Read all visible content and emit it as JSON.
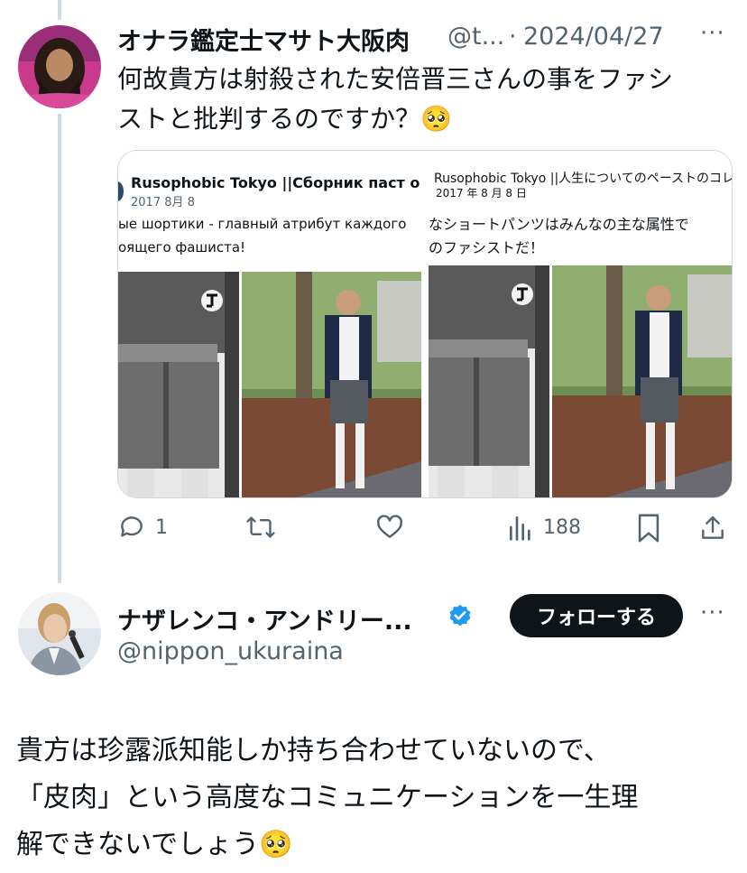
{
  "tweet1": {
    "display_name": "オナラ鑑定士マサト大阪肉",
    "handle": "@t...",
    "separator": "·",
    "date": "2024/04/27",
    "text_line1": "何故貴方は射殺された安倍晋三さんの事をファシ",
    "text_line2": "ストと批判するのですか？",
    "text_emoji": "🥺",
    "image_card": {
      "left": {
        "title": "Rusophobic Tokyo ||Сборник паст о ж",
        "date": "2017 8月 8",
        "line1": "ые шортики - главный атрибут каждого",
        "line2": "оящего фашиста!"
      },
      "right": {
        "title": "Rusophobic  Tokyo  ||人生についてのペーストのコレクシ",
        "date": "2017 年 8 月 8 日",
        "line1": "なショートパンツはみんなの主な属性で",
        "line2": "のファシストだ！"
      }
    },
    "actions": {
      "replies": "1",
      "retweets": "",
      "likes": "",
      "views": "188"
    }
  },
  "tweet2": {
    "display_name": "ナザレンコ・アンドリー...",
    "handle": "@nippon_ukuraina",
    "follow_label": "フォローする",
    "text_line1": "貴方は珍露派知能しか持ち合わせていないので、",
    "text_line2": "「皮肉」という高度なコミュニケーションを一生理",
    "text_line3": "解できないでしょう",
    "text_emoji": "🥺"
  },
  "colors": {
    "muted": "#536471",
    "border": "#cfd9de",
    "verified": "#1d9bf0",
    "button": "#0f1419"
  }
}
